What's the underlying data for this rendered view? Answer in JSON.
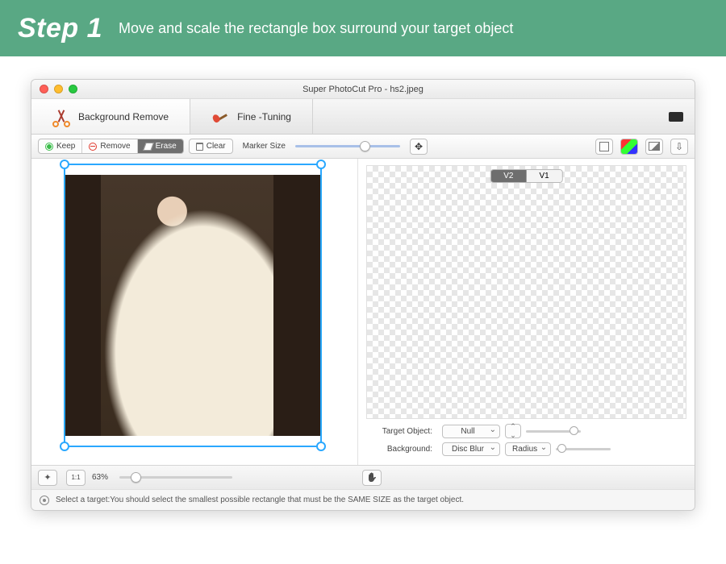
{
  "banner": {
    "step": "Step 1",
    "text": "Move and scale the rectangle box surround your target object"
  },
  "window_title": "Super PhotoCut Pro - hs2.jpeg",
  "tabs": [
    {
      "label": "Background Remove",
      "active": true
    },
    {
      "label": "Fine -Tuning",
      "active": false
    }
  ],
  "toolbar": {
    "keep": "Keep",
    "remove": "Remove",
    "erase": "Erase",
    "clear": "Clear",
    "marker_label": "Marker Size"
  },
  "version": {
    "v2": "V2",
    "v1": "V1",
    "active": "V2"
  },
  "controls": {
    "target_label": "Target Object:",
    "target_value": "Null",
    "bg_label": "Background:",
    "bg_value": "Disc Blur",
    "radius_label": "Radius"
  },
  "footer": {
    "zoom_text": "63%"
  },
  "hint": "Select a target:You should select the smallest possible rectangle that must be the SAME SIZE as the target object."
}
